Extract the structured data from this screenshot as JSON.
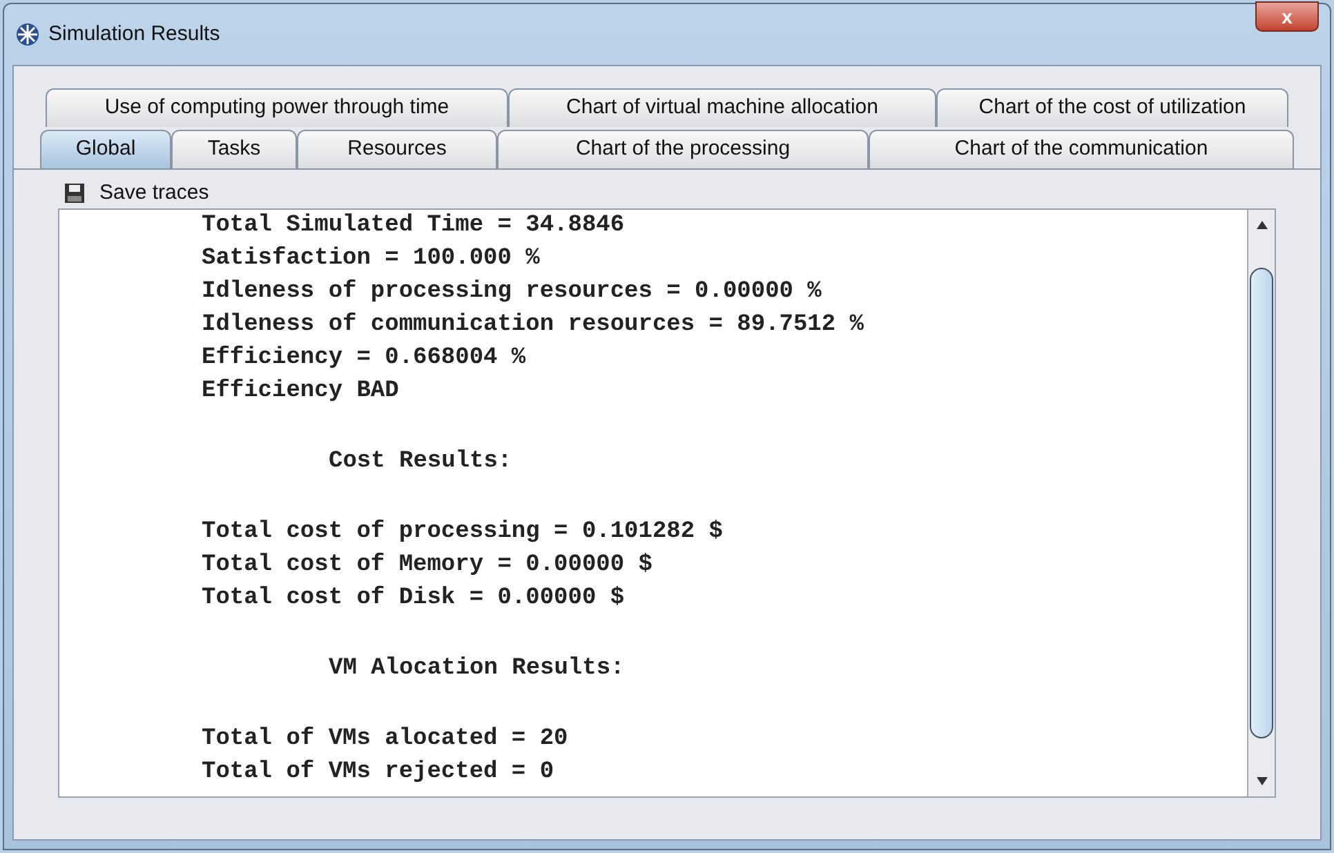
{
  "window": {
    "title": "Simulation Results",
    "close_label": "x"
  },
  "tab_rows": [
    [
      {
        "label": "Use of computing power through time",
        "selected": false
      },
      {
        "label": "Chart of virtual machine allocation",
        "selected": false
      },
      {
        "label": "Chart of the cost of utilization",
        "selected": false
      }
    ],
    [
      {
        "label": "Global",
        "selected": true
      },
      {
        "label": "Tasks",
        "selected": false
      },
      {
        "label": "Resources",
        "selected": false
      },
      {
        "label": "Chart of the processing",
        "selected": false
      },
      {
        "label": "Chart of the communication",
        "selected": false
      }
    ]
  ],
  "toolbar": {
    "save_label": "Save traces"
  },
  "output_lines": [
    {
      "kind": "line",
      "text": "Total Simulated Time = 34.8846"
    },
    {
      "kind": "line",
      "text": "Satisfaction = 100.000 %"
    },
    {
      "kind": "line",
      "text": "Idleness of processing resources = 0.00000 %"
    },
    {
      "kind": "line",
      "text": "Idleness of communication resources = 89.7512 %"
    },
    {
      "kind": "line",
      "text": "Efficiency = 0.668004 %"
    },
    {
      "kind": "line",
      "text": "Efficiency BAD"
    },
    {
      "kind": "blank"
    },
    {
      "kind": "heading",
      "text": "Cost Results:"
    },
    {
      "kind": "blank"
    },
    {
      "kind": "line",
      "text": "Total cost of processing = 0.101282 $"
    },
    {
      "kind": "line",
      "text": "Total cost of Memory = 0.00000 $"
    },
    {
      "kind": "line",
      "text": "Total cost of Disk = 0.00000 $"
    },
    {
      "kind": "blank"
    },
    {
      "kind": "heading",
      "text": "VM Alocation Results:"
    },
    {
      "kind": "blank"
    },
    {
      "kind": "line",
      "text": "Total of VMs alocated = 20"
    },
    {
      "kind": "line",
      "text": "Total of VMs rejected = 0"
    }
  ]
}
